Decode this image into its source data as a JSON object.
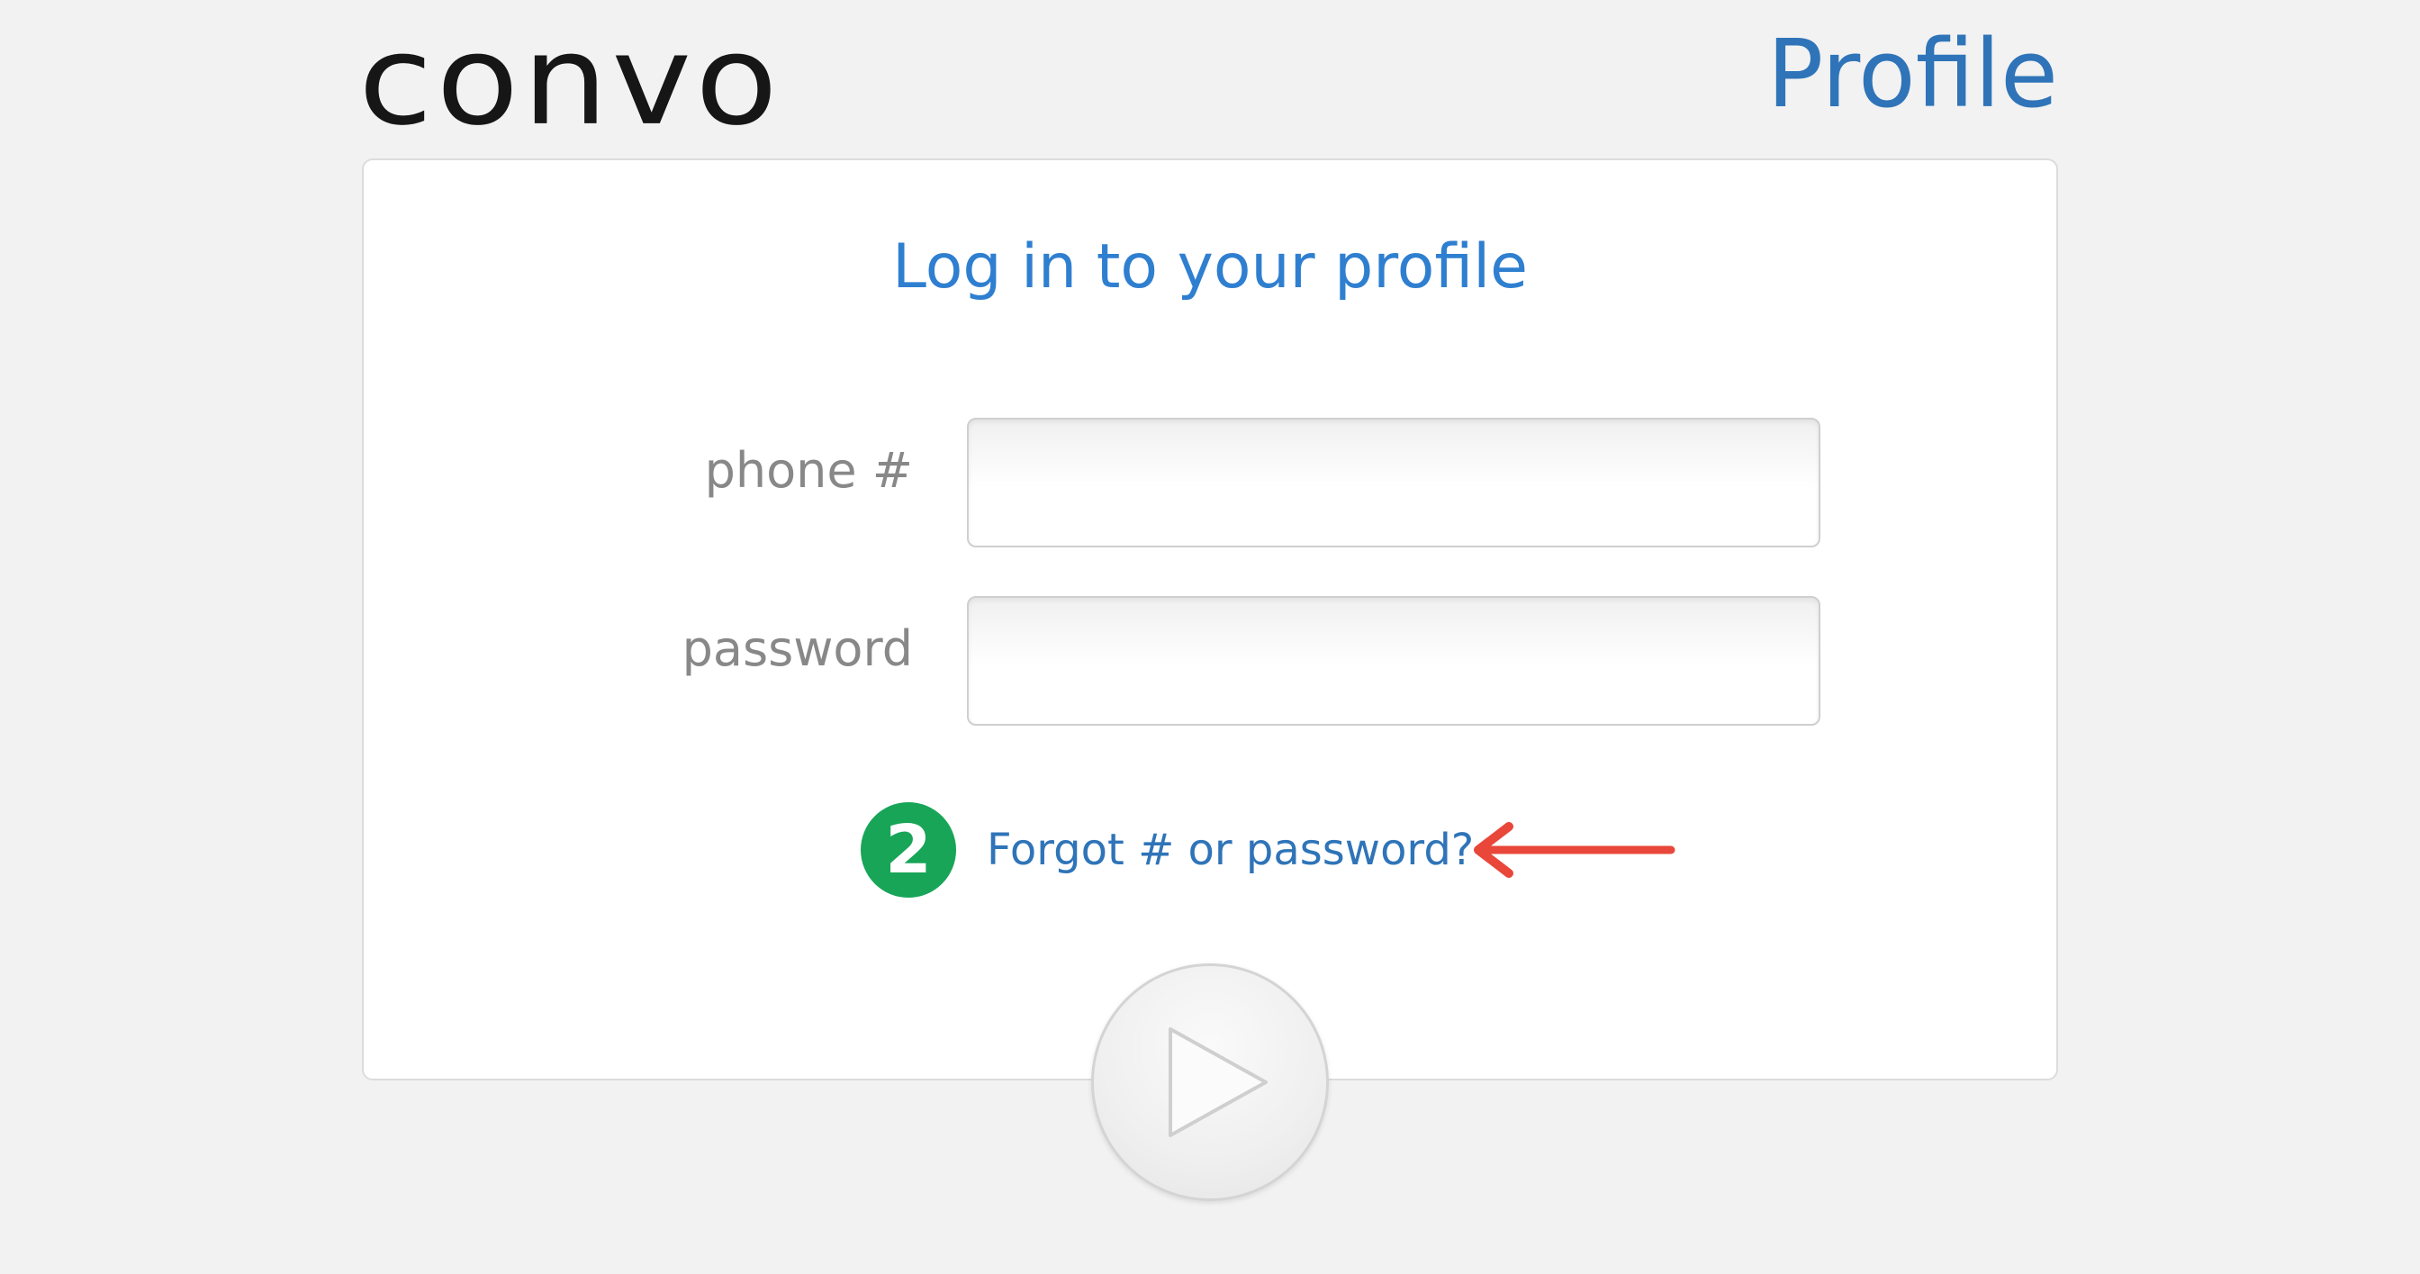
{
  "header": {
    "logo_text": "convo",
    "title": "Profile"
  },
  "card": {
    "heading": "Log in to your profile"
  },
  "form": {
    "phone_label": "phone #",
    "phone_value": "",
    "password_label": "password",
    "password_value": "",
    "forgot_link": "Forgot # or password?"
  },
  "annotation": {
    "step_number": "2",
    "badge_color": "#18a558",
    "arrow_color": "#e8473a"
  },
  "colors": {
    "accent": "#2f74b8",
    "background": "#f2f2f2",
    "card": "#ffffff"
  },
  "icons": {
    "submit": "play-icon",
    "pointer": "arrow-left-icon"
  }
}
